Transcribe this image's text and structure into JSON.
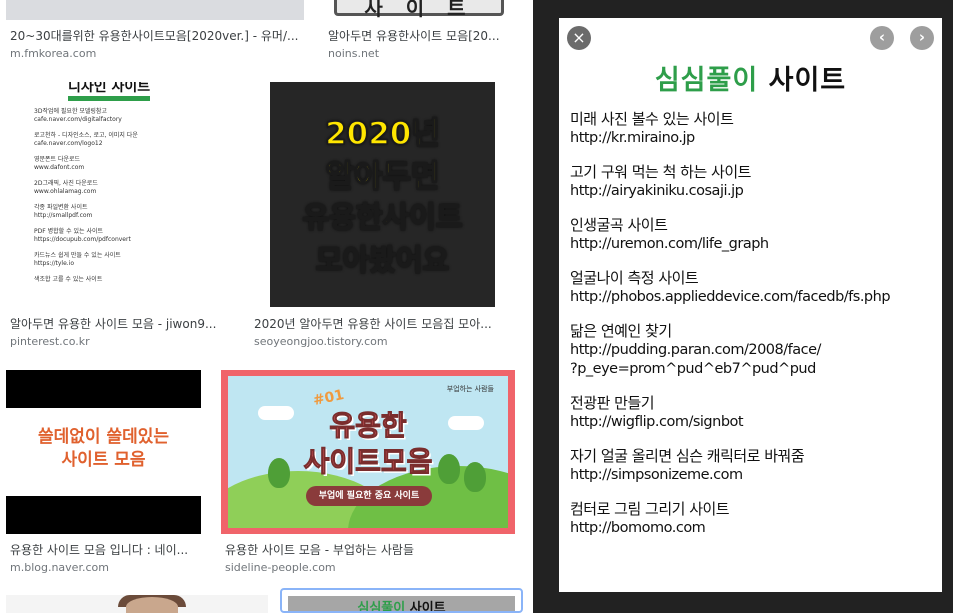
{
  "results": [
    {
      "title": "20~30대를위한 유용한사이트모음[2020ver.] - 유머/...",
      "source": "m.fmkorea.com"
    },
    {
      "title": "알아두면 유용한사이트 모음[20...",
      "source": "noins.net",
      "thumb_text": "사 이 트"
    },
    {
      "title": "알아두면 유용한 사이트 모음 - jiwon9...",
      "source": "pinterest.co.kr",
      "thumb": {
        "heading": "디자인 사이트",
        "items": [
          {
            "name": "3D작업에 필요한 모델링참고",
            "url": "cafe.naver.com/digitalfactory"
          },
          {
            "name": "로고천하 - 디자인소스, 로고, 이미지 다운",
            "url": "cafe.naver.com/logo12"
          },
          {
            "name": "영문폰트 다운로드",
            "url": "www.dafont.com"
          },
          {
            "name": "2D그래픽, 사진 다운로드",
            "url": "www.ohlalamag.com"
          },
          {
            "name": "각종 파일변환 사이트",
            "url": "http://smallpdf.com"
          },
          {
            "name": "PDF 병합할 수 있는 사이트",
            "url": "https://docupub.com/pdfconvert"
          },
          {
            "name": "카드뉴스 쉽게 만들 수 있는 사이트",
            "url": "https://tyle.io"
          },
          {
            "name": "색조합 고를 수 있는 사이트",
            "url": ""
          }
        ]
      }
    },
    {
      "title": "2020년 알아두면 유용한 사이트 모음집 모아...",
      "source": "seoyeongjoo.tistory.com",
      "thumb": {
        "lines": [
          "2020년",
          "알아두면",
          "유용한사이트",
          "모아봤어요"
        ]
      }
    },
    {
      "title": "유용한 사이트 모음 입니다 : 네이...",
      "source": "m.blog.naver.com",
      "thumb": {
        "lines": [
          "쓸데없이 쓸데있는",
          "사이트 모음"
        ]
      }
    },
    {
      "title": "유용한 사이트 모음 - 부업하는 사람들",
      "source": "sideline-people.com",
      "thumb": {
        "number": "#01",
        "line1": "유용한",
        "line2": "사이트모음",
        "pill": "부업에 필요한 중요 사이트",
        "tag": "부업하는 사람들"
      }
    }
  ],
  "bottom_thumb": {
    "title_green": "심심풀이",
    "title_black": "사이트"
  },
  "preview": {
    "close_icon": "×",
    "prev_icon": "‹",
    "next_icon": "›",
    "title_green": "심심풀이",
    "title_black": "사이트",
    "sites": [
      {
        "name": "미래 사진 볼수 있는 사이트",
        "url": "http://kr.miraino.jp"
      },
      {
        "name": "고기 구워 먹는 척 하는 사이트",
        "url": "http://airyakiniku.cosaji.jp"
      },
      {
        "name": "인생굴곡 사이트",
        "url": "http://uremon.com/life_graph"
      },
      {
        "name": "얼굴나이 측정 사이트",
        "url": "http://phobos.applieddevice.com/facedb/fs.php"
      },
      {
        "name": "닮은 연예인 찾기",
        "url": "http://pudding.paran.com/2008/face/",
        "url2": "?p_eye=prom^pud^eb7^pud^pud"
      },
      {
        "name": "전광판 만들기",
        "url": "http://wigflip.com/signbot"
      },
      {
        "name": "자기 얼굴 올리면 심슨 캐릭터로 바꿔줌",
        "url": "http://simpsonizeme.com"
      },
      {
        "name": "컴터로 그림 그리기 사이트",
        "url": "http://bomomo.com"
      }
    ]
  },
  "colors": {
    "accent_green": "#2e9e4a",
    "preview_bg": "#222222",
    "selected_border": "#8ab4f8"
  }
}
